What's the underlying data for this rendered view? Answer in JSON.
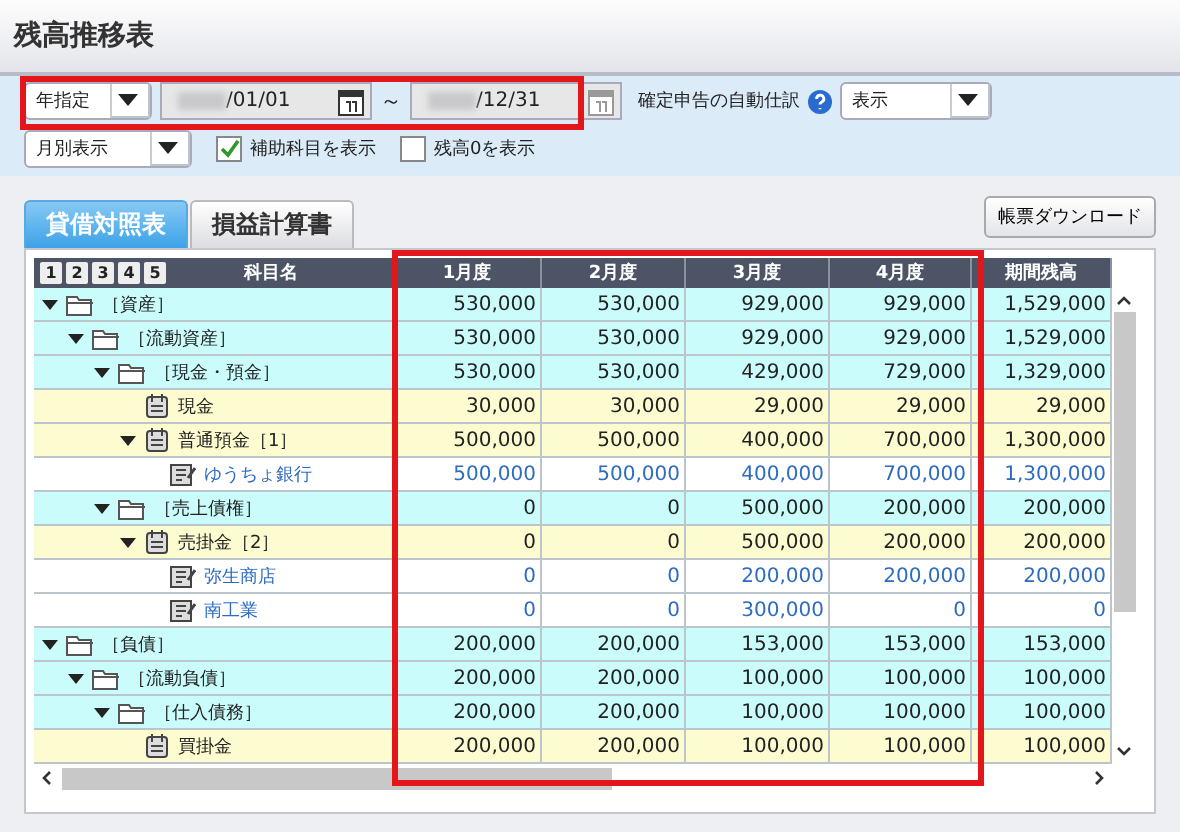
{
  "window": {
    "title": "残高推移表"
  },
  "filters": {
    "period_mode": "年指定",
    "date_from": "/01/01",
    "date_to": "/12/31",
    "date_separator": "～",
    "auto_entry_label": "確定申告の自動仕訳",
    "auto_entry_value": "表示",
    "view_mode": "月別表示",
    "checkboxes": [
      {
        "label": "補助科目を表示",
        "checked": true
      },
      {
        "label": "残高0を表示",
        "checked": false
      }
    ]
  },
  "tabs": [
    {
      "label": "貸借対照表",
      "selected": true
    },
    {
      "label": "損益計算書",
      "selected": false
    }
  ],
  "download_button": "帳票ダウンロード",
  "table": {
    "levels": [
      "1",
      "2",
      "3",
      "4",
      "5"
    ],
    "columns": [
      "科目名",
      "1月度",
      "2月度",
      "3月度",
      "4月度",
      "期間残高"
    ],
    "rows": [
      {
        "kind": "group",
        "label": "［資産］",
        "expanded": true,
        "values": [
          "530,000",
          "530,000",
          "929,000",
          "929,000",
          "1,529,000"
        ],
        "children": [
          {
            "kind": "group",
            "label": "［流動資産］",
            "expanded": true,
            "values": [
              "530,000",
              "530,000",
              "929,000",
              "929,000",
              "1,529,000"
            ],
            "children": [
              {
                "kind": "group",
                "label": "［現金・預金］",
                "expanded": true,
                "values": [
                  "530,000",
                  "530,000",
                  "429,000",
                  "729,000",
                  "1,329,000"
                ],
                "children": [
                  {
                    "kind": "account",
                    "label": "現金",
                    "values": [
                      "30,000",
                      "30,000",
                      "29,000",
                      "29,000",
                      "29,000"
                    ]
                  },
                  {
                    "kind": "account",
                    "label": "普通預金［1］",
                    "expanded": true,
                    "values": [
                      "500,000",
                      "500,000",
                      "400,000",
                      "700,000",
                      "1,300,000"
                    ],
                    "children": [
                      {
                        "kind": "sub",
                        "label": "ゆうちょ銀行",
                        "values": [
                          "500,000",
                          "500,000",
                          "400,000",
                          "700,000",
                          "1,300,000"
                        ]
                      }
                    ]
                  }
                ]
              },
              {
                "kind": "group",
                "label": "［売上債権］",
                "expanded": true,
                "values": [
                  "0",
                  "0",
                  "500,000",
                  "200,000",
                  "200,000"
                ],
                "children": [
                  {
                    "kind": "account",
                    "label": "売掛金［2］",
                    "expanded": true,
                    "values": [
                      "0",
                      "0",
                      "500,000",
                      "200,000",
                      "200,000"
                    ],
                    "children": [
                      {
                        "kind": "sub",
                        "label": "弥生商店",
                        "values": [
                          "0",
                          "0",
                          "200,000",
                          "200,000",
                          "200,000"
                        ]
                      },
                      {
                        "kind": "sub",
                        "label": "南工業",
                        "values": [
                          "0",
                          "0",
                          "300,000",
                          "0",
                          "0"
                        ]
                      }
                    ]
                  }
                ]
              }
            ]
          }
        ]
      },
      {
        "kind": "group",
        "label": "［負債］",
        "expanded": true,
        "values": [
          "200,000",
          "200,000",
          "153,000",
          "153,000",
          "153,000"
        ],
        "children": [
          {
            "kind": "group",
            "label": "［流動負債］",
            "expanded": true,
            "values": [
              "200,000",
              "200,000",
              "100,000",
              "100,000",
              "100,000"
            ],
            "children": [
              {
                "kind": "group",
                "label": "［仕入債務］",
                "expanded": true,
                "values": [
                  "200,000",
                  "200,000",
                  "100,000",
                  "100,000",
                  "100,000"
                ],
                "children": [
                  {
                    "kind": "account",
                    "label": "買掛金",
                    "values": [
                      "200,000",
                      "200,000",
                      "100,000",
                      "100,000",
                      "100,000"
                    ]
                  }
                ]
              }
            ]
          }
        ]
      }
    ]
  }
}
